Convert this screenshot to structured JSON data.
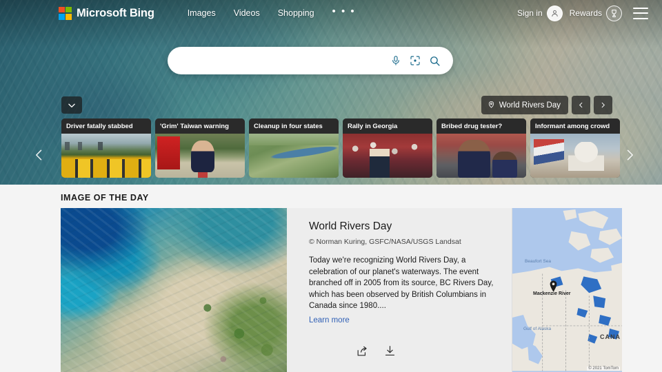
{
  "header": {
    "brand": "Microsoft Bing",
    "logo_icon": "microsoft-logo-icon",
    "logo_colors": [
      "#f25022",
      "#7fba00",
      "#00a4ef",
      "#ffb900"
    ],
    "nav": [
      {
        "label": "Images",
        "name": "nav-images"
      },
      {
        "label": "Videos",
        "name": "nav-videos"
      },
      {
        "label": "Shopping",
        "name": "nav-shopping"
      }
    ],
    "more_label": "• • •",
    "sign_in_label": "Sign in",
    "sign_in_icon": "person-avatar-icon",
    "rewards_label": "Rewards",
    "rewards_icon": "trophy-medal-icon",
    "menu_icon": "hamburger-menu-icon"
  },
  "search": {
    "value": "",
    "placeholder": "",
    "mic_icon": "microphone-icon",
    "lens_icon": "visual-search-camera-icon",
    "submit_icon": "search-magnifier-icon"
  },
  "hero": {
    "collapse_icon": "chevron-down-icon",
    "day_badge_label": "World Rivers Day",
    "day_badge_icon": "location-pin-icon",
    "prev_icon": "chevron-left-icon",
    "next_icon": "chevron-right-icon",
    "carousel_prev_icon": "carousel-chevron-left-icon",
    "carousel_next_icon": "carousel-chevron-right-icon"
  },
  "news_cards": [
    {
      "title": "Driver fatally stabbed",
      "art": "t-buses"
    },
    {
      "title": "'Grim' Taiwan warning",
      "art": "t-xi"
    },
    {
      "title": "Cleanup in four states",
      "art": "t-river"
    },
    {
      "title": "Rally in Georgia",
      "art": "t-rally"
    },
    {
      "title": "Bribed drug tester?",
      "art": "t-football"
    },
    {
      "title": "Informant among crowd",
      "art": "t-capitol"
    },
    {
      "title": "",
      "art": "t-partial"
    }
  ],
  "image_of_the_day": {
    "section_heading": "IMAGE OF THE DAY",
    "title": "World Rivers Day",
    "credit": "© Norman Kuring, GSFC/NASA/USGS Landsat",
    "body": "Today we're recognizing World Rivers Day, a celebration of our planet's waterways. The event branched off in 2005 from its source, BC Rivers Day, which has been observed by British Columbians in Canada since 1980....",
    "link_label": "Learn more",
    "share_icon": "share-icon",
    "download_icon": "download-icon"
  },
  "map": {
    "place_label": "Mackenzie River",
    "pin_icon": "map-pin-icon",
    "water_labels": [
      "Beaufort Sea",
      "Gulf of Alaska"
    ],
    "country_label": "CANA",
    "attribution": "© 2021 TomTom",
    "water_color": "#aec8ec",
    "land_color": "#ebe7df"
  }
}
